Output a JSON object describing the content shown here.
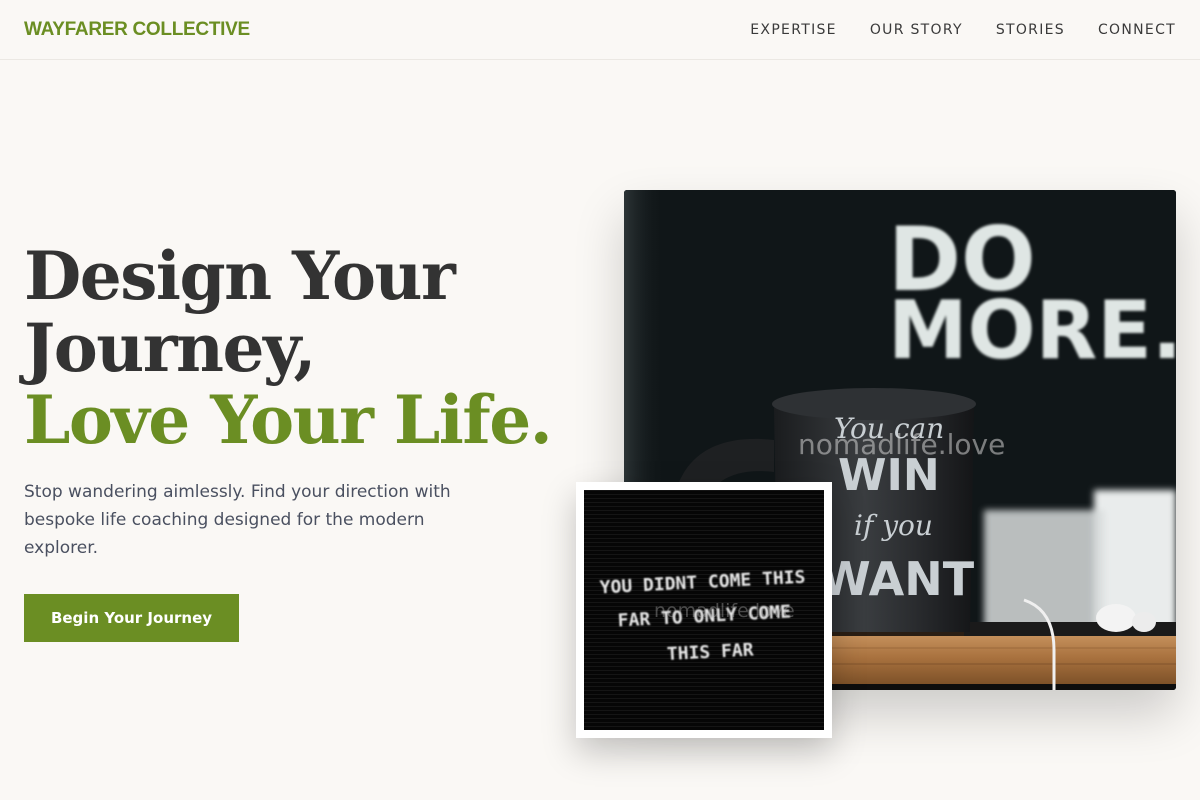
{
  "brand": {
    "name": "WAYFARER COLLECTIVE"
  },
  "nav": {
    "items": [
      {
        "label": "EXPERTISE"
      },
      {
        "label": "OUR STORY"
      },
      {
        "label": "STORIES"
      },
      {
        "label": "CONNECT"
      }
    ]
  },
  "hero": {
    "title_line1": "Design Your",
    "title_line2": "Journey,",
    "title_line3": "Love Your Life.",
    "description": "Stop wandering aimlessly. Find your direction with bespoke life coaching designed for the modern explorer.",
    "cta_label": "Begin Your Journey"
  },
  "images": {
    "main": {
      "sign_line1": "DO",
      "sign_line2": "MORE.",
      "mug_line1": "You can",
      "mug_line2": "WIN",
      "mug_line3": "if you",
      "mug_line4": "WANT",
      "watermark": "nomadlife.love"
    },
    "small": {
      "board_line1": "YOU DIDNT COME THIS",
      "board_line2": "FAR TO ONLY COME",
      "board_line3": "THIS FAR",
      "watermark": "nomadlife.love"
    }
  },
  "colors": {
    "accent": "#6b8e23",
    "background": "#faf8f5",
    "heading": "#333333",
    "body_text": "#4a5060"
  }
}
